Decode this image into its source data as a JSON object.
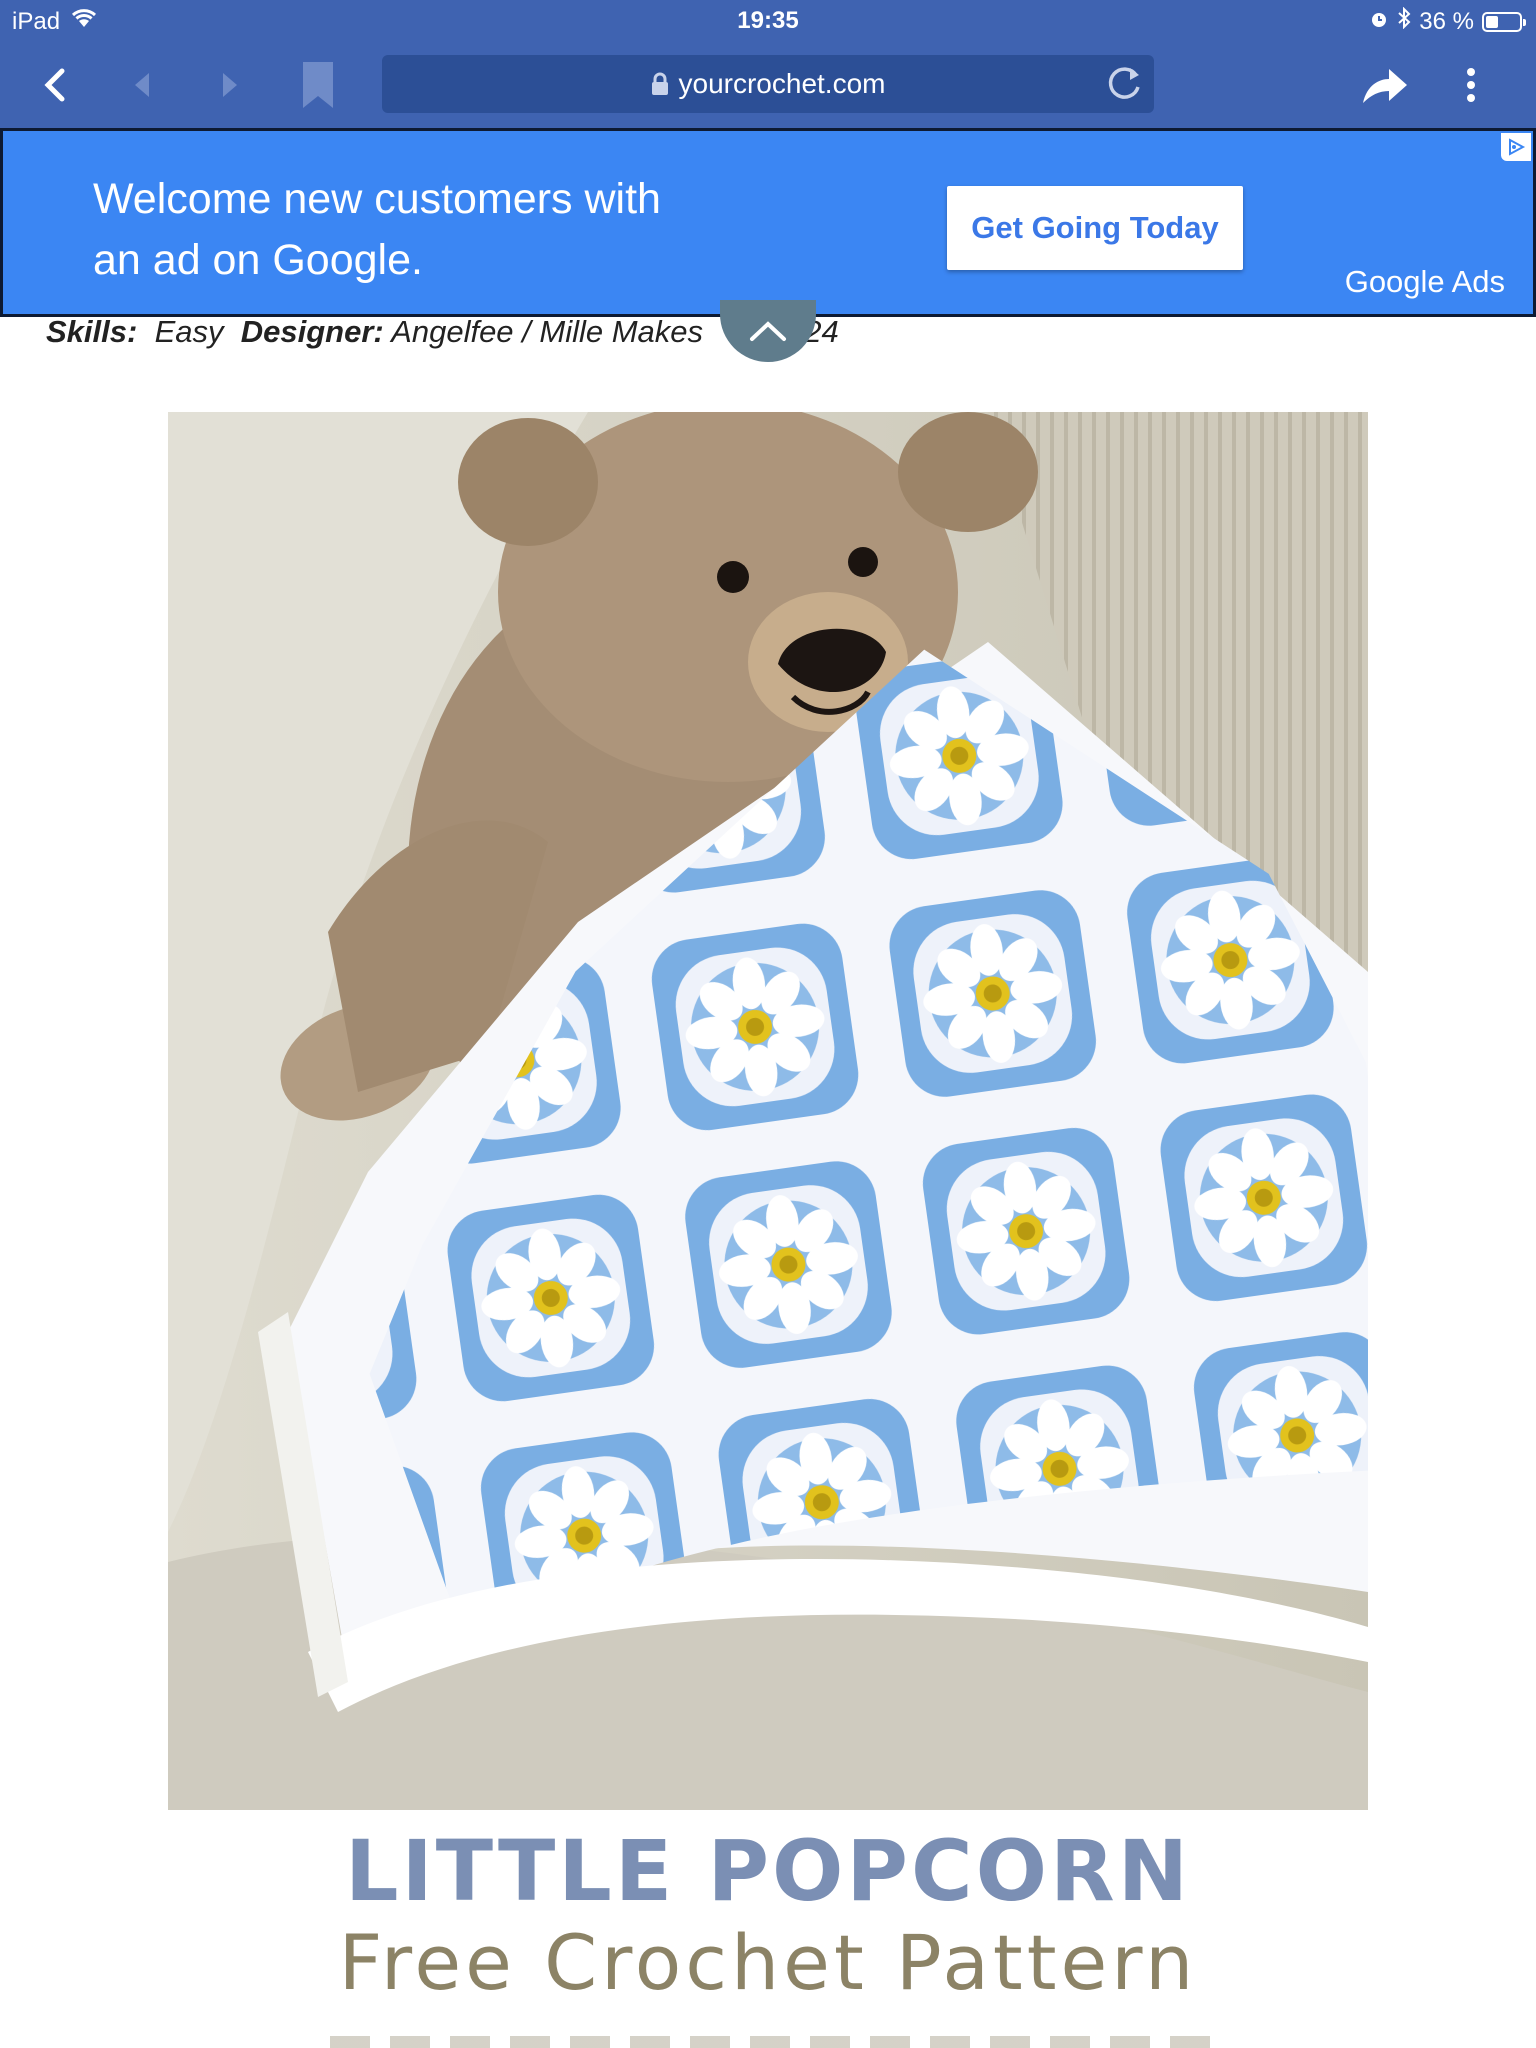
{
  "status_bar": {
    "device": "iPad",
    "time": "19:35",
    "battery_percent": "36 %",
    "battery_level": 0.36
  },
  "browser": {
    "url": "yourcrochet.com"
  },
  "ad": {
    "headline": "Welcome new customers with an ad on Google.",
    "cta": "Get Going Today",
    "brand": "Google Ads"
  },
  "pattern_meta": {
    "skills_label": "Skills:",
    "skills_value": "Easy",
    "designer_label": "Designer:",
    "designer_value": "Angelfee / Mille Makes",
    "trailing": "24"
  },
  "hero": {
    "title": "LITTLE POPCORN",
    "subtitle": "Free Crochet Pattern"
  },
  "colors": {
    "chrome": "#3f63b1",
    "ad_background": "#3b86f3",
    "title_blue": "#7b8fb4",
    "subtitle_olive": "#8c8366",
    "blanket_blue": "#7aaee3"
  }
}
